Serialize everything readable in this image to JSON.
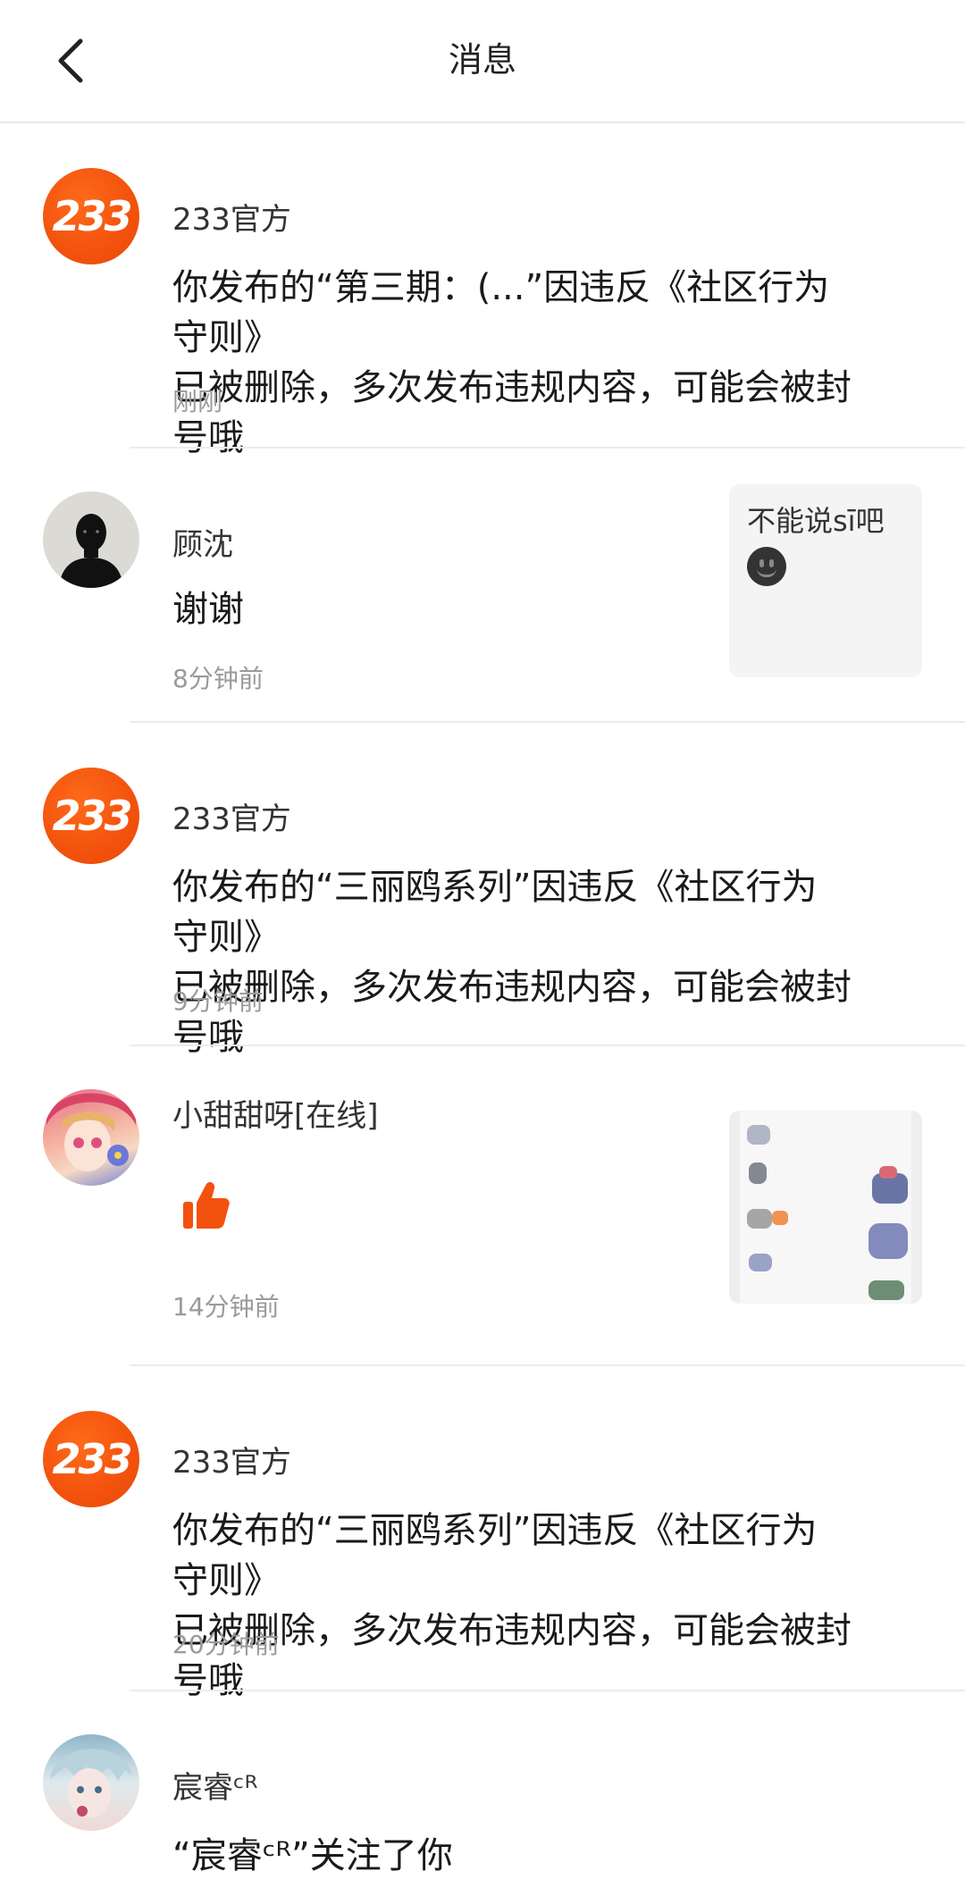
{
  "header": {
    "title": "消息",
    "back_icon": "chevron-left-icon"
  },
  "colors": {
    "brand_orange": "#F2520D",
    "time_gray": "#9A9A9A",
    "divider": "#ECECEC"
  },
  "messages": [
    {
      "avatar": "233-logo",
      "avatar_text": "233",
      "sender": "233官方",
      "content_line1": "你发布的“第三期：(...”因违反《社区行为守则》",
      "content_line2": "已被删除，多次发布违规内容，可能会被封号哦",
      "time": "刚刚"
    },
    {
      "avatar": "silhouette-avatar",
      "sender": "顾沈",
      "content": "谢谢",
      "time": "8分钟前",
      "thumb_text": "不能说sī吧",
      "thumb_icon": "smiley-icon"
    },
    {
      "avatar": "233-logo",
      "avatar_text": "233",
      "sender": "233官方",
      "content_line1": "你发布的“三丽鸥系列”因违反《社区行为守则》",
      "content_line2": "已被删除，多次发布违规内容，可能会被封号哦",
      "time": "9分钟前"
    },
    {
      "avatar": "anime-girl-avatar",
      "sender": "小甜甜呀[在线]",
      "content_icon": "thumbs-up-icon",
      "time": "14分钟前",
      "thumb_icon": "blurred-image-thumbnail"
    },
    {
      "avatar": "233-logo",
      "avatar_text": "233",
      "sender": "233官方",
      "content_line1": "你发布的“三丽鸥系列”因违反《社区行为守则》",
      "content_line2": "已被删除，多次发布违规内容，可能会被封号哦",
      "time": "20分钟前"
    },
    {
      "avatar": "anime-boy-avatar",
      "sender": "宸睿ᶜᴿ",
      "content": "“宸睿ᶜᴿ”关注了你"
    }
  ]
}
